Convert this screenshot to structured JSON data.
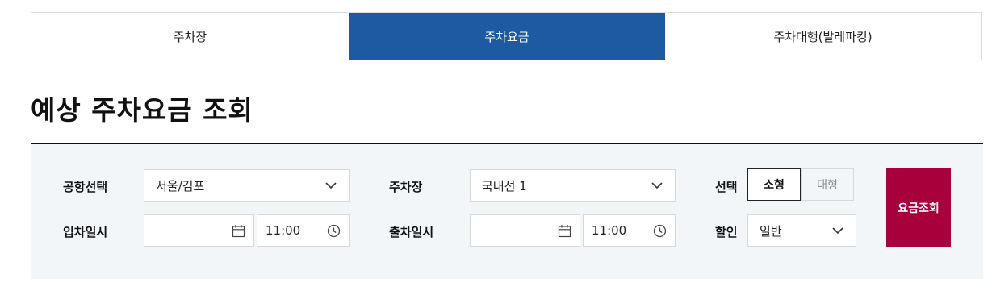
{
  "tabs": [
    {
      "label": "주차장"
    },
    {
      "label": "주차요금"
    },
    {
      "label": "주차대행(발레파킹)"
    }
  ],
  "page_title": "예상 주차요금 조회",
  "form": {
    "airport_label": "공항선택",
    "airport_value": "서울/김포",
    "parking_label": "주차장",
    "parking_value": "국내선 1",
    "type_label": "선택",
    "type_options": [
      "소형",
      "대형"
    ],
    "type_selected": "소형",
    "entry_label": "입차일시",
    "entry_date": "",
    "entry_time": "11:00",
    "exit_label": "출차일시",
    "exit_date": "",
    "exit_time": "11:00",
    "discount_label": "할인",
    "discount_value": "일반",
    "submit_label": "요금조회"
  },
  "colors": {
    "active_tab": "#1d5aa2",
    "submit_button": "#a8003b",
    "panel_bg": "#f3f6f9"
  },
  "icons": {
    "select": "chevron-down-icon",
    "date": "calendar-icon",
    "time": "clock-icon"
  }
}
